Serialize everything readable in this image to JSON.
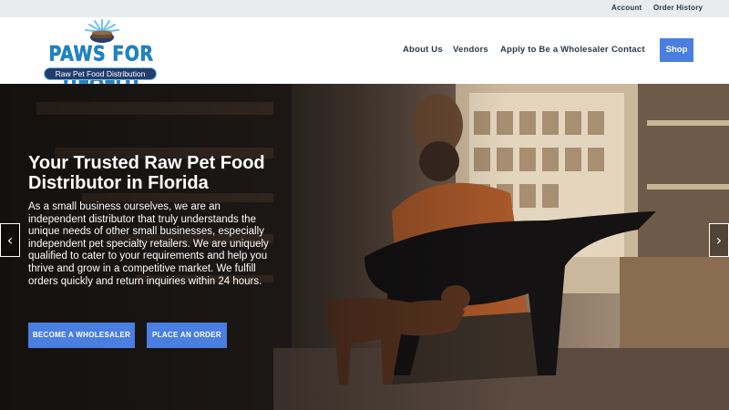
{
  "topbar": {
    "account": "Account",
    "order_history": "Order History"
  },
  "logo": {
    "name": "PAWS FOR HEALTH",
    "tagline": "Raw Pet Food Distribution"
  },
  "nav": {
    "items": [
      "About Us",
      "Vendors",
      "Apply to Be a Wholesaler",
      "Contact"
    ],
    "shop": "Shop"
  },
  "hero": {
    "title": "Your Trusted Raw Pet Food Distributor in Florida",
    "body": "As a small business ourselves, we are an independent distributor that truly understands the unique needs of other small businesses, especially independent pet specialty retailers. We are uniquely qualified to cater to your requirements and help you thrive and grow in a competitive market. We fulfill orders quickly and return inquiries within 24 hours.",
    "buttons": {
      "wholesaler": "BECOME A WHOLESALER",
      "order": "PLACE AN ORDER"
    },
    "prev_arrow": "‹",
    "next_arrow": "›"
  },
  "colors": {
    "accent": "#4a7ee0",
    "nav_text": "#2b3947",
    "logo_blue": "#1c86c8",
    "logo_navy": "#243c6e"
  }
}
